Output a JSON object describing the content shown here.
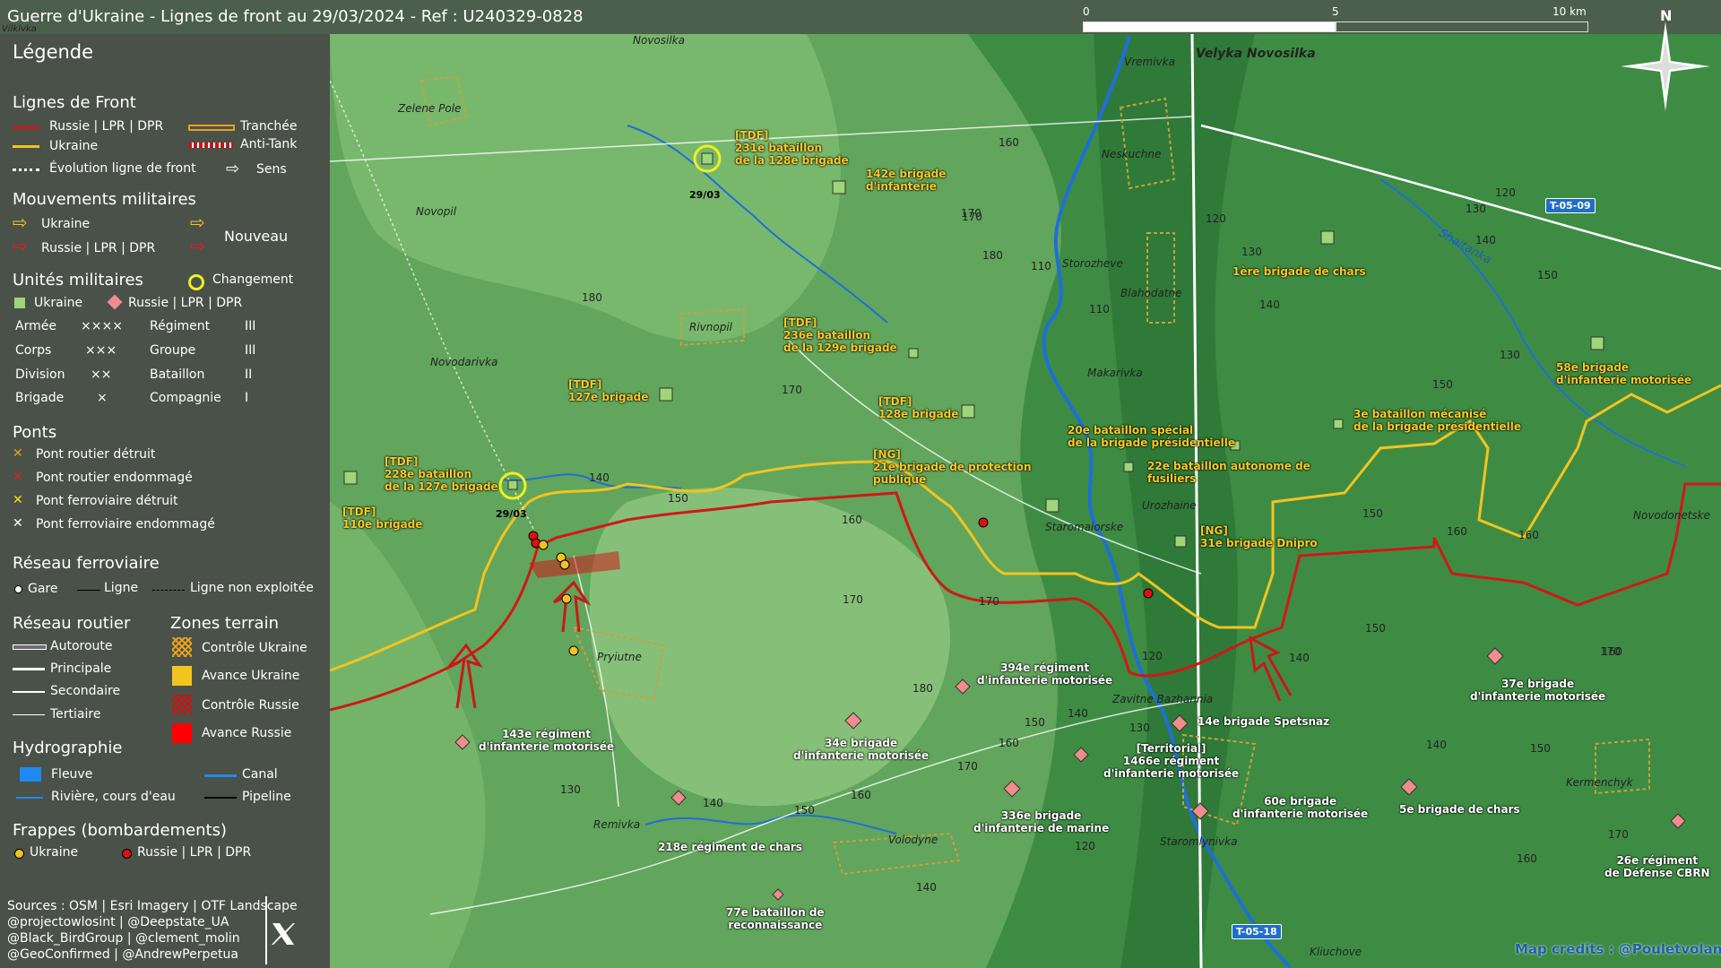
{
  "header": {
    "title": "Guerre d'Ukraine - Lignes de front au 29/03/2024 - Ref : U240329-0828",
    "scale_labels": [
      "0",
      "5",
      "10 km"
    ],
    "north_label": "N"
  },
  "legend": {
    "title": "Légende",
    "front_lines": {
      "heading": "Lignes de Front",
      "russia": "Russie | LPR | DPR",
      "ukraine": "Ukraine",
      "evolution": "Évolution ligne de front",
      "trench": "Tranchée",
      "antitank": "Anti-Tank",
      "direction": "Sens"
    },
    "movements": {
      "heading": "Mouvements militaires",
      "ukraine": "Ukraine",
      "russia": "Russie | LPR | DPR",
      "new": "Nouveau"
    },
    "units": {
      "heading": "Unités militaires",
      "change": "Changement",
      "ukraine": "Ukraine",
      "russia": "Russie | LPR | DPR",
      "rows": [
        {
          "name": "Armée",
          "sym": "××××",
          "name2": "Régiment",
          "sym2": "III"
        },
        {
          "name": "Corps",
          "sym": "×××",
          "name2": "Groupe",
          "sym2": "III"
        },
        {
          "name": "Division",
          "sym": "××",
          "name2": "Bataillon",
          "sym2": "II"
        },
        {
          "name": "Brigade",
          "sym": "×",
          "name2": "Compagnie",
          "sym2": "I"
        }
      ]
    },
    "bridges": {
      "heading": "Ponts",
      "items": [
        "Pont routier détruit",
        "Pont routier endommagé",
        "Pont ferroviaire détruit",
        "Pont ferroviaire endommagé"
      ],
      "colors": [
        "#e8a21a",
        "#e02020",
        "#f2e21a",
        "#ffffff"
      ]
    },
    "rail": {
      "heading": "Réseau ferroviaire",
      "station": "Gare",
      "line": "Ligne",
      "unused": "Ligne non exploitée"
    },
    "roads": {
      "heading": "Réseau routier",
      "items": [
        "Autoroute",
        "Principale",
        "Secondaire",
        "Tertiaire"
      ]
    },
    "terrain": {
      "heading": "Zones terrain",
      "items": [
        "Contrôle Ukraine",
        "Avance Ukraine",
        "Contrôle Russie",
        "Avance Russie"
      ]
    },
    "hydro": {
      "heading": "Hydrographie",
      "river_big": "Fleuve",
      "canal": "Canal",
      "river_small": "Rivière, cours d'eau",
      "pipeline": "Pipeline"
    },
    "strikes": {
      "heading": "Frappes (bombardements)",
      "ukraine": "Ukraine",
      "russia": "Russie | LPR | DPR"
    },
    "sources": [
      "Sources : OSM | Esri Imagery | OTF Landscape",
      "@projectowlosint | @Deepstate_UA",
      "@Black_BirdGroup | @clement_molin",
      "@GeoConfirmed | @AndrewPerpetua"
    ]
  },
  "colors": {
    "russia": "#d01818",
    "ukraine": "#f2c420",
    "trench": "#e8a020",
    "river": "#1e6fd8",
    "ru_unit": "#f08c8c",
    "ua_unit": "#9ed67a"
  },
  "map": {
    "places": [
      {
        "name": "Velyka Novosilka",
        "big": true
      },
      {
        "name": "Novosilka"
      },
      {
        "name": "Vremivka"
      },
      {
        "name": "Zelene Pole"
      },
      {
        "name": "Neskuchne"
      },
      {
        "name": "Novopil"
      },
      {
        "name": "Storozheve"
      },
      {
        "name": "Blahodatne"
      },
      {
        "name": "Rivnopil"
      },
      {
        "name": "Novodarivka"
      },
      {
        "name": "Makarivka"
      },
      {
        "name": "Urozhaine"
      },
      {
        "name": "Staromaiorske"
      },
      {
        "name": "Pryiutne"
      },
      {
        "name": "Zavitne Bazhannia"
      },
      {
        "name": "Remivka"
      },
      {
        "name": "Volodyne"
      },
      {
        "name": "Staromlynivka"
      },
      {
        "name": "Kermenchyk"
      },
      {
        "name": "Novodonetske"
      },
      {
        "name": "Kliuchove"
      },
      {
        "name": "Vilkivka"
      }
    ],
    "river_name": "Shaitanka",
    "elevations": [
      "160",
      "170",
      "180",
      "120",
      "130",
      "140",
      "110",
      "110",
      "130",
      "140",
      "120",
      "150",
      "130",
      "150",
      "180",
      "170",
      "140",
      "150",
      "160",
      "170",
      "170",
      "160",
      "150",
      "120",
      "140",
      "170",
      "180",
      "150",
      "140",
      "130",
      "150",
      "140",
      "160",
      "170",
      "130",
      "140",
      "150",
      "160",
      "170",
      "160",
      "120",
      "140",
      "150",
      "160",
      "170",
      "160"
    ],
    "roads": [
      "T-05-09",
      "T-05-18"
    ],
    "dates": [
      "29/03",
      "29/03"
    ],
    "ua_units": [
      "[TDF]\n231e bataillon\nde la 128e brigade",
      "142e brigade\nd'infanterie",
      "[TDF]\n236e bataillon\nde la 129e brigade",
      "[TDF]\n127e brigade",
      "[TDF]\n128e brigade",
      "[TDF]\n228e bataillon\nde la 127e brigade",
      "[TDF]\n110e brigade",
      "[NG]\n21e brigade de protection\npublique",
      "1ère brigade de chars",
      "58e brigade\nd'infanterie motorisée",
      "3e bataillon mécanisé\nde la brigade présidentielle",
      "20e bataillon spécial\nde la brigade présidentielle",
      "22e bataillon autonome de\nfusiliers",
      "[NG]\n31e brigade Dnipro"
    ],
    "ru_units": [
      "143e régiment\nd'infanterie motorisée",
      "394e régiment\nd'infanterie motorisée",
      "34e brigade\nd'infanterie motorisée",
      "[Territorial]\n1466e régiment\nd'infanterie motorisée",
      "14e brigade Spetsnaz",
      "37e brigade\nd'infanterie motorisée",
      "336e brigade\nd'infanterie de marine",
      "60e brigade\nd'infanterie motorisée",
      "5e brigade de chars",
      "218e régiment de chars",
      "77e bataillon de\nreconnaissance",
      "26e régiment\nde Défense CBRN"
    ],
    "credit": "Map credits : @Pouletvolant3"
  }
}
